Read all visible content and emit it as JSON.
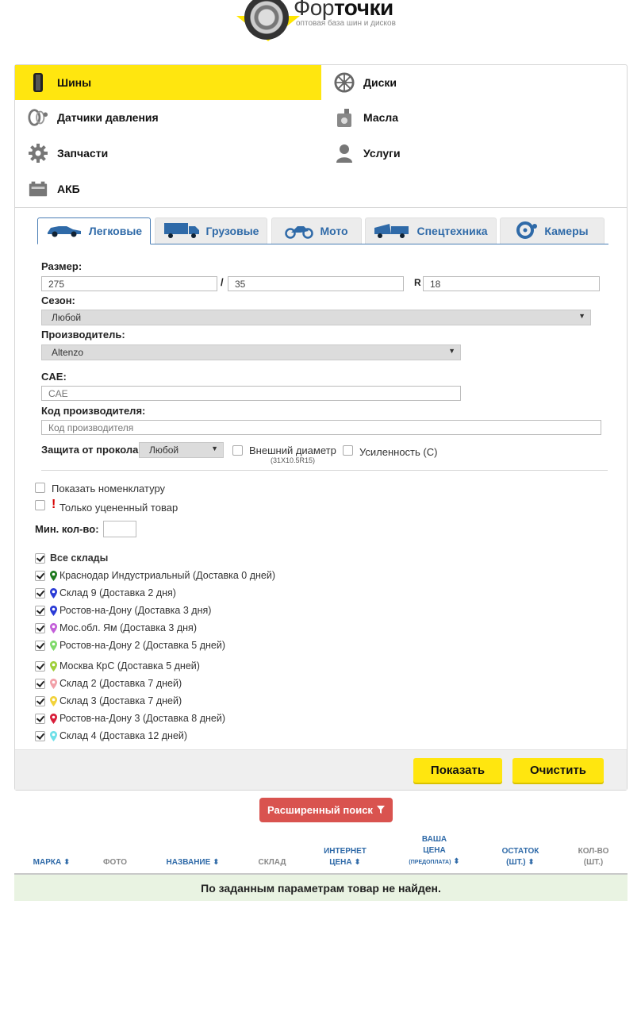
{
  "logo": {
    "name_light": "Фор",
    "name_bold": "точки",
    "subtitle": "оптовая база шин и дисков"
  },
  "categories": [
    {
      "label": "Шины",
      "icon": "tire-icon",
      "active": true
    },
    {
      "label": "Диски",
      "icon": "wheel-rim-icon",
      "active": false
    },
    {
      "label": "Датчики давления",
      "icon": "pressure-sensor-icon",
      "active": false
    },
    {
      "label": "Масла",
      "icon": "oil-canister-icon",
      "active": false
    },
    {
      "label": "Запчасти",
      "icon": "gear-icon",
      "active": false
    },
    {
      "label": "Услуги",
      "icon": "person-icon",
      "active": false
    },
    {
      "label": "АКБ",
      "icon": "battery-icon",
      "active": false
    }
  ],
  "vehicle_tabs": [
    {
      "label": "Легковые",
      "icon": "car-icon",
      "active": true
    },
    {
      "label": "Грузовые",
      "icon": "truck-icon",
      "active": false
    },
    {
      "label": "Мото",
      "icon": "motorcycle-icon",
      "active": false
    },
    {
      "label": "Спецтехника",
      "icon": "special-vehicle-icon",
      "active": false
    },
    {
      "label": "Камеры",
      "icon": "inner-tube-icon",
      "active": false
    }
  ],
  "form": {
    "size_label": "Размер:",
    "width_value": "275",
    "slash": "/",
    "profile_value": "35",
    "r_label": "R",
    "diameter_value": "18",
    "season_label": "Сезон:",
    "season_value": "Любой",
    "maker_label": "Производитель:",
    "maker_value": "Altenzo",
    "cae_label": "CAE:",
    "cae_placeholder": "CAE",
    "code_label": "Код производителя:",
    "code_placeholder": "Код производителя",
    "puncture_label": "Защита от прокола",
    "puncture_value": "Любой",
    "outer_diam_label": "Внешний диаметр",
    "outer_diam_hint": "(31X10.5R15)",
    "reinforced_label": "Усиленность (C)",
    "show_nomenclature_label": "Показать номенклатуру",
    "discount_mark": "!",
    "discount_only_label": "Только уцененный товар",
    "min_qty_label": "Мин. кол-во:",
    "min_qty_value": ""
  },
  "warehouses_all_label": "Все склады",
  "warehouses": [
    {
      "label": "Краснодар Индустриальный (Доставка 0 дней)",
      "pin_color": "#1e7a1e",
      "checked": true
    },
    {
      "label": "Склад 9 (Доставка 2 дня)",
      "pin_color": "#2a3bd6",
      "checked": true
    },
    {
      "label": "Ростов-на-Дону (Доставка 3 дня)",
      "pin_color": "#2a3bd6",
      "checked": true
    },
    {
      "label": "Мос.обл. Ям (Доставка 3 дня)",
      "pin_color": "#c35fd9",
      "checked": true
    },
    {
      "label": "Ростов-на-Дону 2 (Доставка 5 дней)",
      "pin_color": "#7fd96a",
      "checked": true
    },
    {
      "label": "Москва КрС (Доставка 5 дней)",
      "pin_color": "#9fcf3a",
      "checked": true
    },
    {
      "label": "Склад 2 (Доставка 7 дней)",
      "pin_color": "#f2a0a8",
      "checked": true
    },
    {
      "label": "Склад 3 (Доставка 7 дней)",
      "pin_color": "#f2d23a",
      "checked": true
    },
    {
      "label": "Ростов-на-Дону 3 (Доставка 8 дней)",
      "pin_color": "#d81e3a",
      "checked": true
    },
    {
      "label": "Склад 4 (Доставка 12 дней)",
      "pin_color": "#6fe0e8",
      "checked": true
    }
  ],
  "buttons": {
    "show": "Показать",
    "clear": "Очистить",
    "advanced": "Расширенный поиск"
  },
  "table": {
    "col_brand": "МАРКА",
    "col_photo": "ФОТО",
    "col_name": "НАЗВАНИЕ",
    "col_stock_place": "СКЛАД",
    "col_internet_1": "ИНТЕРНЕТ",
    "col_internet_2": "ЦЕНА",
    "col_your_1": "ВАША",
    "col_your_2": "ЦЕНА",
    "col_your_3": "(ПРЕДОПЛАТА)",
    "col_rest_1": "ОСТАТОК",
    "col_rest_2": "(ШТ.)",
    "col_qty_1": "КОЛ-ВО",
    "col_qty_2": "(ШТ.)",
    "sort_glyph": "⬍",
    "empty_message": "По заданным параметрам товар не найден."
  }
}
